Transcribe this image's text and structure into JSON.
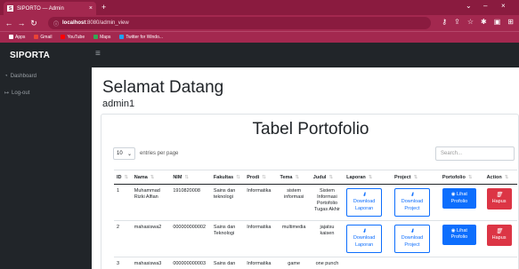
{
  "browser": {
    "tab_title": "SIPORTO — Admin",
    "favicon": "S",
    "url_host": "localhost",
    "url_path": ":8080/admin_view",
    "bookmarks": [
      {
        "label": "Apps",
        "color": "#ffffff"
      },
      {
        "label": "Gmail",
        "color": "#ea4335"
      },
      {
        "label": "YouTube",
        "color": "#ff0000"
      },
      {
        "label": "Maps",
        "color": "#34a853"
      },
      {
        "label": "Twitter for Windo...",
        "color": "#1da1f2"
      }
    ]
  },
  "app": {
    "brand": "SIPORTA",
    "sidebar": [
      {
        "icon": "dashboard-icon",
        "label": "Dashboard"
      },
      {
        "icon": "logout-icon",
        "label": "Log-out"
      }
    ],
    "welcome": "Selamat Datang",
    "username": "admin1"
  },
  "table_card": {
    "title": "Tabel Portofolio",
    "length_value": "10",
    "length_suffix": "entries per page",
    "search_placeholder": "Search...",
    "columns": [
      "ID",
      "Nama",
      "NIM",
      "Fakultas",
      "Prodi",
      "Tema",
      "Judul",
      "Laporan",
      "Project",
      "Portofolio",
      "Action"
    ],
    "rows": [
      {
        "id": "1",
        "nama": "Muhammad Rizki Alfian",
        "nim": "1910820008",
        "fakultas": "Sains dan teknologi",
        "prodi": "Informatika",
        "tema": "sistem informasi",
        "judul": "Sistem Informasi Portofolio Tugas Akhir"
      },
      {
        "id": "2",
        "nama": "mahasiswa2",
        "nim": "000000000002",
        "fakultas": "Sains dan Teknologi",
        "prodi": "Informatika",
        "tema": "multimedia",
        "judul": "jajatsu kaisen"
      },
      {
        "id": "3",
        "nama": "mahasiswa3",
        "nim": "000000000003",
        "fakultas": "Sains dan",
        "prodi": "Informatika",
        "tema": "game",
        "judul": "one punch"
      }
    ],
    "buttons": {
      "download_laporan": "Download Laporan",
      "download_project": "Download Project",
      "lihat_portofolio": "Lihat Profolio",
      "hapus": "Hapus"
    }
  },
  "colors": {
    "browser_chrome": "#a3284f",
    "app_dark": "#212529",
    "primary": "#0d6efd",
    "danger": "#dc3545"
  }
}
